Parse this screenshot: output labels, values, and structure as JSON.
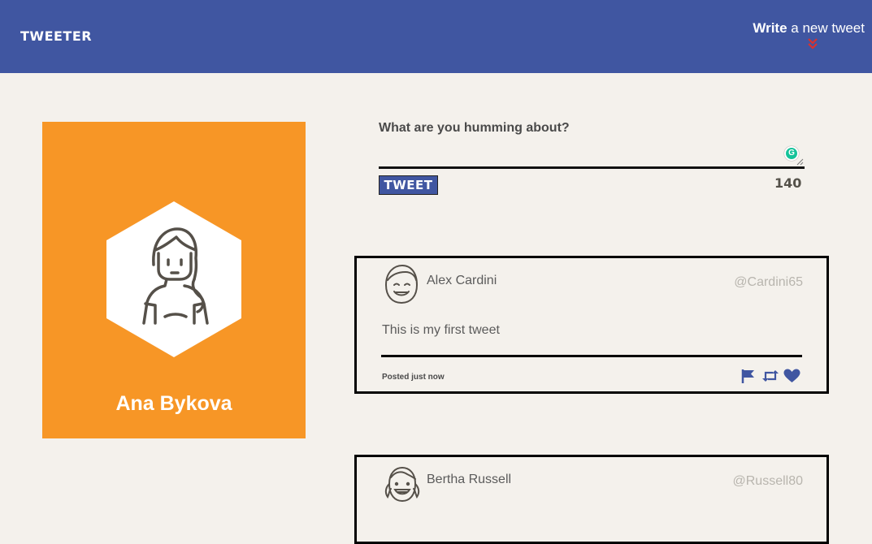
{
  "header": {
    "brand": "TWEETER",
    "compose_toggle_strong": "Write",
    "compose_toggle_rest": " a new tweet"
  },
  "profile": {
    "name": "Ana Bykova"
  },
  "compose": {
    "label": "What are you humming about?",
    "placeholder": "",
    "button_label": "TWEET",
    "counter": "140"
  },
  "tweets": [
    {
      "name": "Alex Cardini",
      "handle": "@Cardini65",
      "text": "This is my first tweet",
      "posted": "Posted just now",
      "actions": [
        "flag-icon",
        "retweet-icon",
        "heart-icon"
      ]
    },
    {
      "name": "Bertha Russell",
      "handle": "@Russell80"
    }
  ],
  "colors": {
    "nav": "#4056a1",
    "profile_card": "#f79626",
    "background": "#f4f1ec",
    "accent_arrows": "#d9322e"
  }
}
